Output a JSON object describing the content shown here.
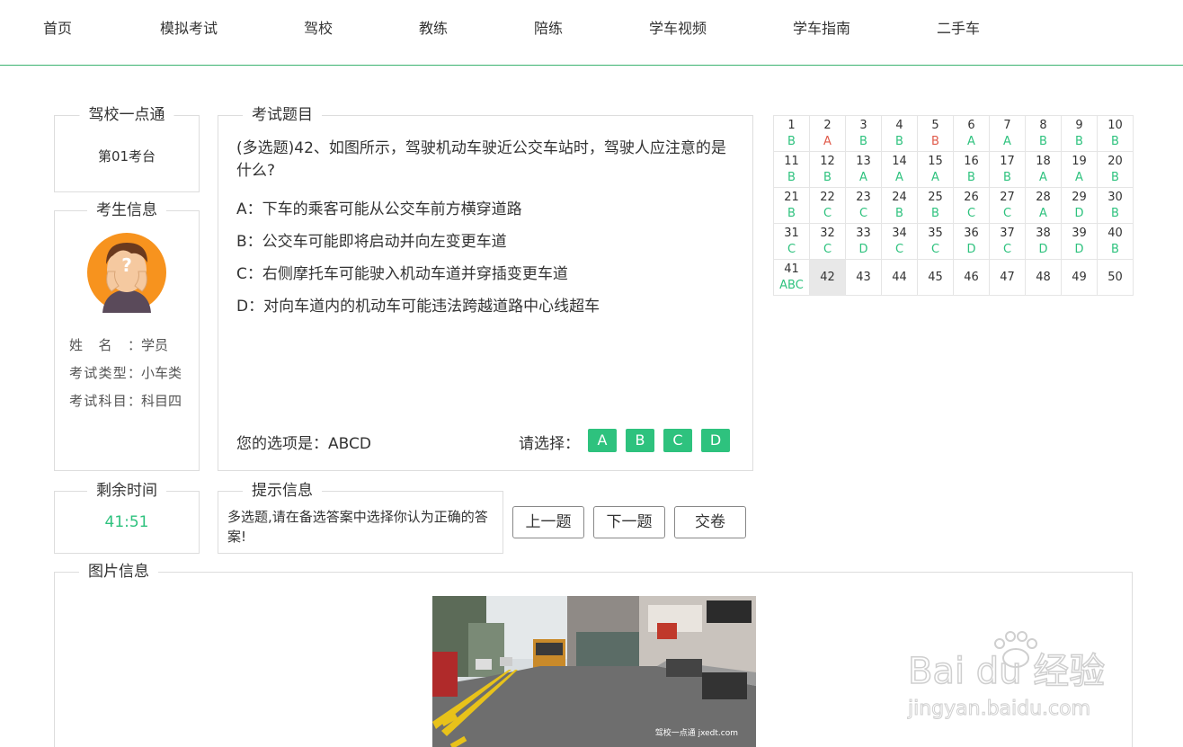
{
  "nav": {
    "items": [
      "首页",
      "模拟考试",
      "驾校",
      "教练",
      "陪练",
      "学车视频",
      "学车指南",
      "二手车"
    ]
  },
  "school": {
    "title": "驾校一点通",
    "station": "第01考台"
  },
  "candidate": {
    "title": "考生信息",
    "rows": [
      {
        "label": "姓名：",
        "value": "学员"
      },
      {
        "label": "考试类型：",
        "value": "小车类"
      },
      {
        "label": "考试科目：",
        "value": "科目四"
      }
    ]
  },
  "question": {
    "title": "考试题目",
    "text": "(多选题)42、如图所示，驾驶机动车驶近公交车站时，驾驶人应注意的是什么?",
    "options": [
      "A：下车的乘客可能从公交车前方横穿道路",
      "B：公交车可能即将启动并向左变更车道",
      "C：右侧摩托车可能驶入机动车道并穿插变更车道",
      "D：对向车道内的机动车可能违法跨越道路中心线超车"
    ],
    "your_choice_label": "您的选项是：",
    "your_choice": "ABCD",
    "select_label": "请选择：",
    "buttons": [
      "A",
      "B",
      "C",
      "D"
    ]
  },
  "answer_grid": [
    {
      "n": "1",
      "a": "B",
      "s": "ok"
    },
    {
      "n": "2",
      "a": "A",
      "s": "wrong"
    },
    {
      "n": "3",
      "a": "B",
      "s": "ok"
    },
    {
      "n": "4",
      "a": "B",
      "s": "ok"
    },
    {
      "n": "5",
      "a": "B",
      "s": "wrong"
    },
    {
      "n": "6",
      "a": "A",
      "s": "ok"
    },
    {
      "n": "7",
      "a": "A",
      "s": "ok"
    },
    {
      "n": "8",
      "a": "B",
      "s": "ok"
    },
    {
      "n": "9",
      "a": "B",
      "s": "ok"
    },
    {
      "n": "10",
      "a": "B",
      "s": "ok"
    },
    {
      "n": "11",
      "a": "B",
      "s": "ok"
    },
    {
      "n": "12",
      "a": "B",
      "s": "ok"
    },
    {
      "n": "13",
      "a": "A",
      "s": "ok"
    },
    {
      "n": "14",
      "a": "A",
      "s": "ok"
    },
    {
      "n": "15",
      "a": "A",
      "s": "ok"
    },
    {
      "n": "16",
      "a": "B",
      "s": "ok"
    },
    {
      "n": "17",
      "a": "B",
      "s": "ok"
    },
    {
      "n": "18",
      "a": "A",
      "s": "ok"
    },
    {
      "n": "19",
      "a": "A",
      "s": "ok"
    },
    {
      "n": "20",
      "a": "B",
      "s": "ok"
    },
    {
      "n": "21",
      "a": "B",
      "s": "ok"
    },
    {
      "n": "22",
      "a": "C",
      "s": "ok"
    },
    {
      "n": "23",
      "a": "C",
      "s": "ok"
    },
    {
      "n": "24",
      "a": "B",
      "s": "ok"
    },
    {
      "n": "25",
      "a": "B",
      "s": "ok"
    },
    {
      "n": "26",
      "a": "C",
      "s": "ok"
    },
    {
      "n": "27",
      "a": "C",
      "s": "ok"
    },
    {
      "n": "28",
      "a": "A",
      "s": "ok"
    },
    {
      "n": "29",
      "a": "D",
      "s": "ok"
    },
    {
      "n": "30",
      "a": "B",
      "s": "ok"
    },
    {
      "n": "31",
      "a": "C",
      "s": "ok"
    },
    {
      "n": "32",
      "a": "C",
      "s": "ok"
    },
    {
      "n": "33",
      "a": "D",
      "s": "ok"
    },
    {
      "n": "34",
      "a": "C",
      "s": "ok"
    },
    {
      "n": "35",
      "a": "C",
      "s": "ok"
    },
    {
      "n": "36",
      "a": "D",
      "s": "ok"
    },
    {
      "n": "37",
      "a": "C",
      "s": "ok"
    },
    {
      "n": "38",
      "a": "D",
      "s": "ok"
    },
    {
      "n": "39",
      "a": "D",
      "s": "ok"
    },
    {
      "n": "40",
      "a": "B",
      "s": "ok"
    },
    {
      "n": "41",
      "a": "ABC",
      "s": "ok"
    },
    {
      "n": "42",
      "a": "",
      "s": "current"
    },
    {
      "n": "43",
      "a": "",
      "s": "none"
    },
    {
      "n": "44",
      "a": "",
      "s": "none"
    },
    {
      "n": "45",
      "a": "",
      "s": "none"
    },
    {
      "n": "46",
      "a": "",
      "s": "none"
    },
    {
      "n": "47",
      "a": "",
      "s": "none"
    },
    {
      "n": "48",
      "a": "",
      "s": "none"
    },
    {
      "n": "49",
      "a": "",
      "s": "none"
    },
    {
      "n": "50",
      "a": "",
      "s": "none"
    }
  ],
  "time": {
    "title": "剩余时间",
    "value": "41:51"
  },
  "hint": {
    "title": "提示信息",
    "text": "多选题,请在备选答案中选择你认为正确的答案!"
  },
  "controls": {
    "prev": "上一题",
    "next": "下一题",
    "submit": "交卷"
  },
  "picture": {
    "title": "图片信息",
    "caption": "驾校一点通 jxedt.com"
  },
  "watermark": {
    "brand": "Bai du 经验",
    "url": "jingyan.baidu.com"
  },
  "colors": {
    "accent": "#2ec27e",
    "wrong": "#e05a4a",
    "nav_line": "#3cb371"
  }
}
